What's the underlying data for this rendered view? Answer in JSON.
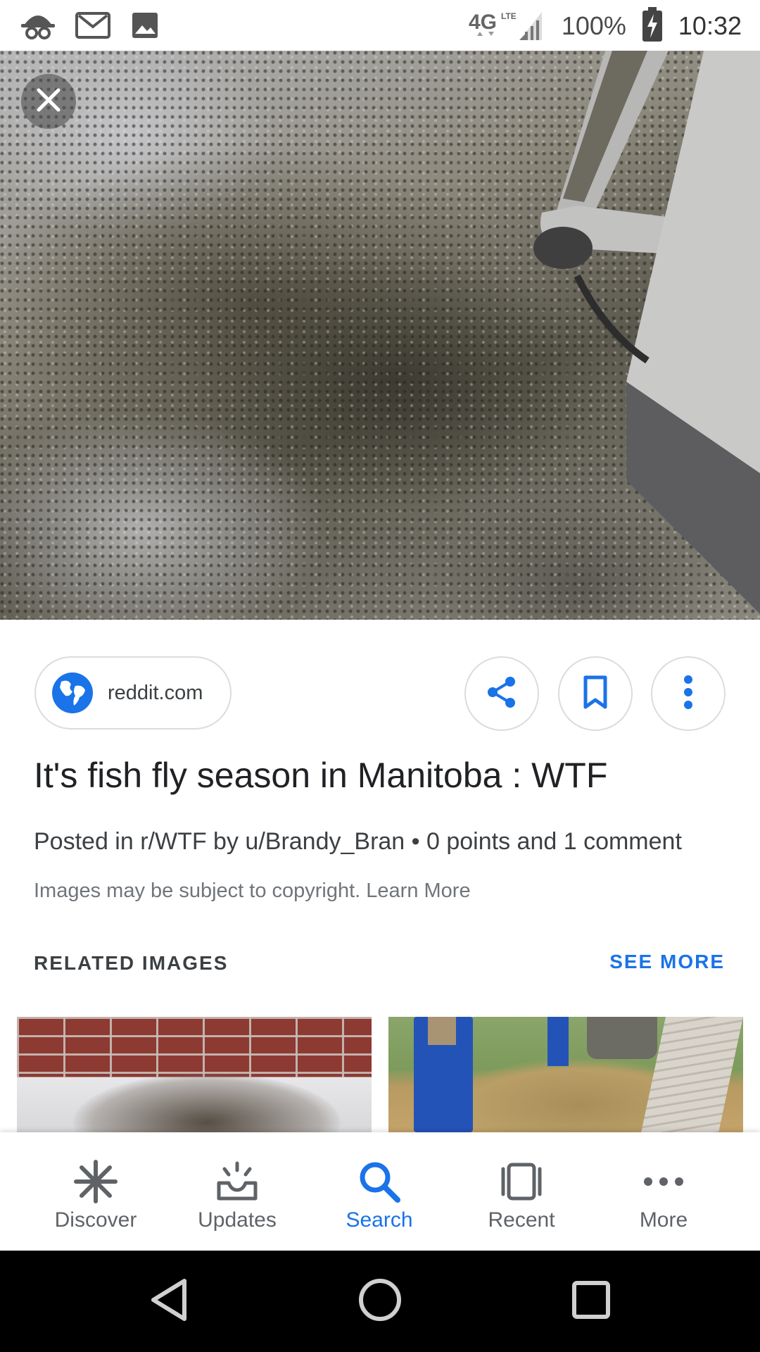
{
  "status_bar": {
    "network": "4G LTE",
    "battery": "100%",
    "time": "10:32",
    "icons": [
      "incognito-icon",
      "gmail-icon",
      "image-icon",
      "signal-icon",
      "battery-charging-icon"
    ]
  },
  "viewer": {
    "close_icon": "close-icon"
  },
  "result": {
    "source": "reddit.com",
    "title": "It's fish fly season in Manitoba : WTF",
    "meta": "Posted in r/WTF by u/Brandy_Bran • 0 points and 1 comment",
    "copyright_text": "Images may be subject to copyright.",
    "learn_more": "Learn More",
    "actions": [
      "share-icon",
      "bookmark-icon",
      "more-vert-icon"
    ]
  },
  "related": {
    "title": "RELATED IMAGES",
    "see_more": "SEE MORE"
  },
  "bottom_nav": {
    "items": [
      {
        "label": "Discover",
        "icon": "discover-icon"
      },
      {
        "label": "Updates",
        "icon": "updates-icon"
      },
      {
        "label": "Search",
        "icon": "search-icon",
        "active": true
      },
      {
        "label": "Recent",
        "icon": "recent-icon"
      },
      {
        "label": "More",
        "icon": "more-horiz-icon"
      }
    ]
  },
  "colors": {
    "accent": "#1a73e8",
    "text_primary": "#202124",
    "text_secondary": "#70757a"
  }
}
